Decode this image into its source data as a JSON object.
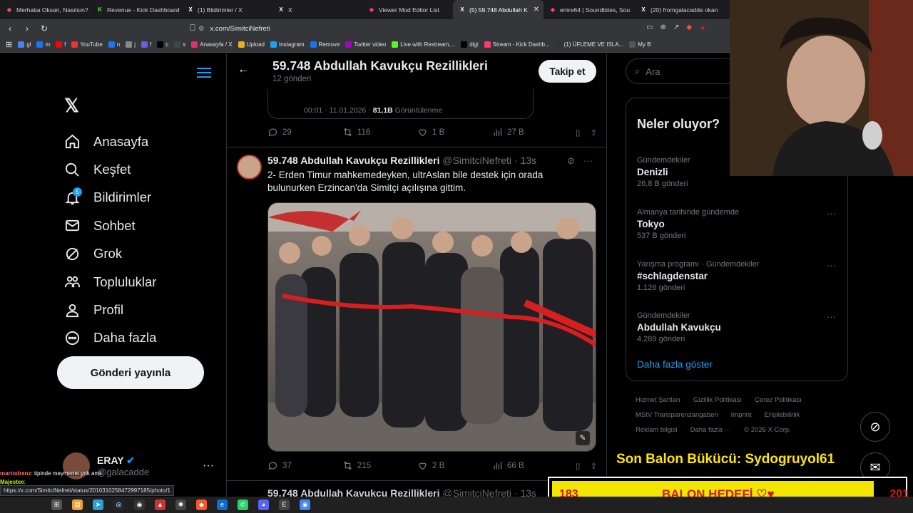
{
  "browser": {
    "tabs": [
      {
        "title": "Merhaba Oksan, Nasılsın?",
        "icon": "warning-icon",
        "color": "#ff4a4a"
      },
      {
        "title": "Revenue - Kick Dashboard",
        "icon": "kick-icon",
        "color": "#53fc18"
      },
      {
        "title": "(1) Bildirimler / X",
        "icon": "x-icon",
        "color": "#ffffff"
      },
      {
        "title": "X",
        "icon": "x-icon",
        "color": "#ffffff"
      },
      {
        "title": "Viewer Mod Editor List",
        "icon": "stream-icon",
        "color": "#ff3a6e"
      },
      {
        "title": "(5) 59.748 Abdullah K",
        "icon": "x-icon",
        "color": "#ffffff",
        "active": true
      },
      {
        "title": "emre64 | Soundbites, Sou",
        "icon": "stream-icon",
        "color": "#ff3a6e"
      },
      {
        "title": "(20) fromgalacadde okan",
        "icon": "x-icon",
        "color": "#ffffff"
      }
    ],
    "url": "x.com/SimitciNefreti",
    "bookmarks": [
      "gl",
      "m",
      "f",
      "YouTube",
      "n",
      "j",
      "f",
      "c",
      "s",
      "Anasayfa / X",
      "Upload",
      "Instagram",
      "Remove",
      "Twitter video",
      "Live with Restream,...",
      "digi",
      "Stream - Kick Dashb...",
      "(1) ÜFLEME VE ISLA...",
      "My B"
    ]
  },
  "sidebar": {
    "items": [
      {
        "label": "Anasayfa",
        "icon": "home-icon"
      },
      {
        "label": "Keşfet",
        "icon": "search-icon"
      },
      {
        "label": "Bildirimler",
        "icon": "bell-icon",
        "badge": "5"
      },
      {
        "label": "Sohbet",
        "icon": "mail-icon"
      },
      {
        "label": "Grok",
        "icon": "grok-icon"
      },
      {
        "label": "Topluluklar",
        "icon": "people-icon"
      },
      {
        "label": "Profil",
        "icon": "user-icon"
      },
      {
        "label": "Daha fazla",
        "icon": "more-icon"
      }
    ],
    "post_button": "Gönderi yayınla",
    "account": {
      "name": "ERAY",
      "handle": "@galacadde"
    }
  },
  "header": {
    "title": "59.748 Abdullah Kavukçu Rezillikleri",
    "subtitle": "12 gönderi",
    "follow": "Takip et"
  },
  "prev_tweet": {
    "card_meta": "00:01 · 11.01.2026 ·",
    "card_views": "81,1B",
    "card_views_label": "Görüntülenme",
    "replies": "29",
    "reposts": "116",
    "likes": "1 B",
    "views": "27 B"
  },
  "tweet": {
    "name": "59.748 Abdullah Kavukçu Rezillikleri",
    "handle": "@SimitciNefreti · 13s",
    "text": "2- Erden Timur mahkemedeyken, ultrAslan bile destek için orada bulunurken Erzincan'da Simitçi açılışına gittim.",
    "replies": "37",
    "reposts": "215",
    "likes": "2 B",
    "views": "66 B"
  },
  "next_tweet": {
    "name": "59.748 Abdullah Kavukçu Rezillikleri",
    "handle": "@SimitciNefreti · 13s"
  },
  "right": {
    "search_placeholder": "Ara",
    "trends_title": "Neler oluyor?",
    "trends": [
      {
        "category": "Gündemdekiler",
        "topic": "Denizli",
        "count": "26,8 B gönderi"
      },
      {
        "category": "Almanya tarihinde gündemde",
        "topic": "Tokyo",
        "count": "537 B gönderi"
      },
      {
        "category": "Yarışma programı · Gündemdekiler",
        "topic": "#schlagdenstar",
        "count": "1.126 gönderi"
      },
      {
        "category": "Gündemdekiler",
        "topic": "Abdullah Kavukçu",
        "count": "4.289 gönderi"
      }
    ],
    "show_more": "Daha fazla göster",
    "footer_links": [
      "Hizmet Şartları",
      "Gizlilik Politikası",
      "Çerez Politikası",
      "MStV Transparenzangaben",
      "Imprint",
      "Erişilebilirlik",
      "Reklam bilgisi",
      "Daha fazla ···",
      "© 2026 X Corp."
    ]
  },
  "overlay": {
    "balon_title": "Son Balon Bükücü: Sydogruyol61",
    "goal_left": "183",
    "goal_center": "BALON HEDEFİ ♡♥",
    "goal_right": "201",
    "chat": [
      {
        "user": "martodrenz",
        "msg": ": tipinde meymenet yok amk"
      },
      {
        "user": "Majestee",
        "msg": ":"
      },
      {
        "user": "Majestee",
        "msg": ":"
      },
      {
        "user": "Majestee",
        "msg": ":"
      }
    ],
    "status_url": "https://x.com/SimitciNefreti/status/2010310258472997185/photo/1"
  }
}
